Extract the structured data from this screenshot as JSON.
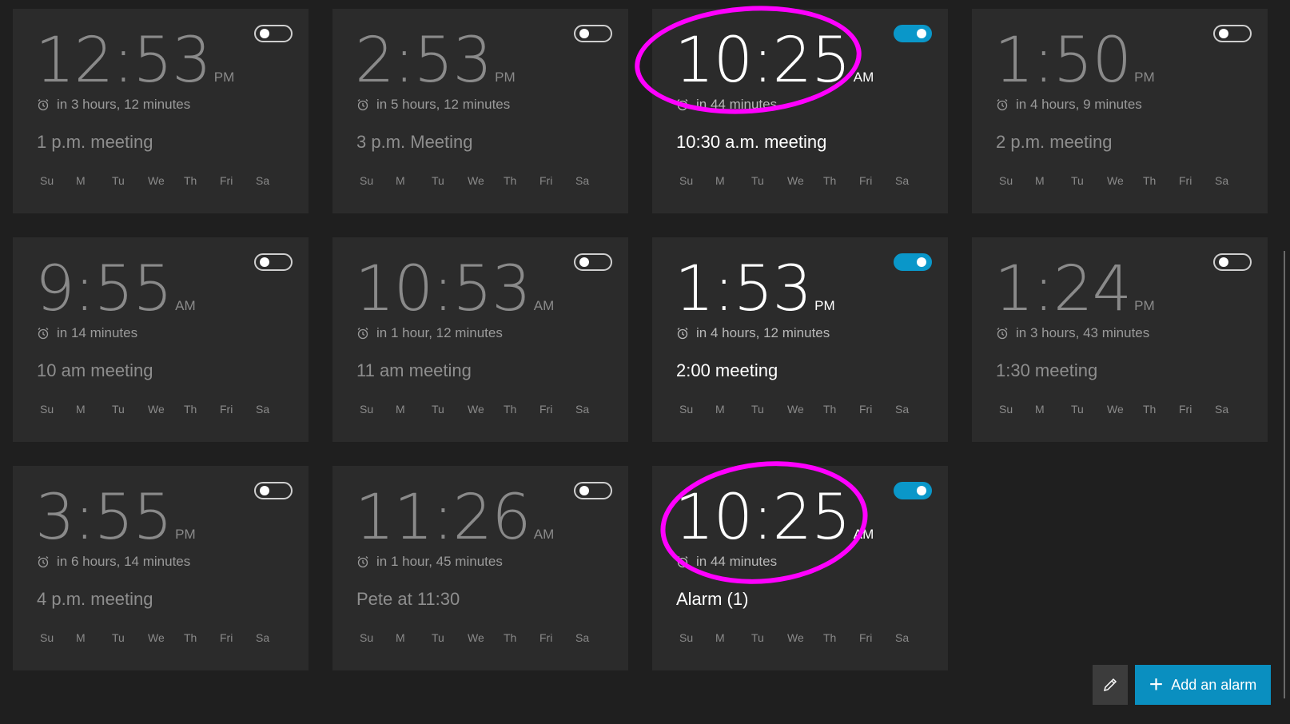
{
  "alarms": [
    {
      "time": "12:53",
      "ampm": "PM",
      "relative": "in 3 hours, 12 minutes",
      "name": "1 p.m. meeting",
      "on": false
    },
    {
      "time": "2:53",
      "ampm": "PM",
      "relative": "in 5 hours, 12 minutes",
      "name": "3 p.m. Meeting",
      "on": false
    },
    {
      "time": "10:25",
      "ampm": "AM",
      "relative": "in 44 minutes",
      "name": "10:30 a.m. meeting",
      "on": true
    },
    {
      "time": "1:50",
      "ampm": "PM",
      "relative": "in 4 hours, 9 minutes",
      "name": "2 p.m. meeting",
      "on": false
    },
    {
      "time": "9:55",
      "ampm": "AM",
      "relative": "in 14 minutes",
      "name": "10 am meeting",
      "on": false
    },
    {
      "time": "10:53",
      "ampm": "AM",
      "relative": "in 1 hour, 12 minutes",
      "name": "11 am meeting",
      "on": false
    },
    {
      "time": "1:53",
      "ampm": "PM",
      "relative": "in 4 hours, 12 minutes",
      "name": "2:00 meeting",
      "on": true
    },
    {
      "time": "1:24",
      "ampm": "PM",
      "relative": "in 3 hours, 43 minutes",
      "name": "1:30 meeting",
      "on": false
    },
    {
      "time": "3:55",
      "ampm": "PM",
      "relative": "in 6 hours, 14 minutes",
      "name": "4 p.m. meeting",
      "on": false
    },
    {
      "time": "11:26",
      "ampm": "AM",
      "relative": "in 1 hour, 45 minutes",
      "name": "Pete at 11:30",
      "on": false
    },
    {
      "time": "10:25",
      "ampm": "AM",
      "relative": "in 44 minutes",
      "name": "Alarm (1)",
      "on": true
    }
  ],
  "days": [
    "Su",
    "M",
    "Tu",
    "We",
    "Th",
    "Fri",
    "Sa"
  ],
  "actions": {
    "add_label": "Add an alarm",
    "edit_icon": "pencil-icon",
    "add_icon": "plus-icon"
  },
  "colors": {
    "accent": "#0a97c9",
    "highlight": "#ff00ff",
    "card": "#2b2b2b",
    "background": "#1f1f1f"
  }
}
